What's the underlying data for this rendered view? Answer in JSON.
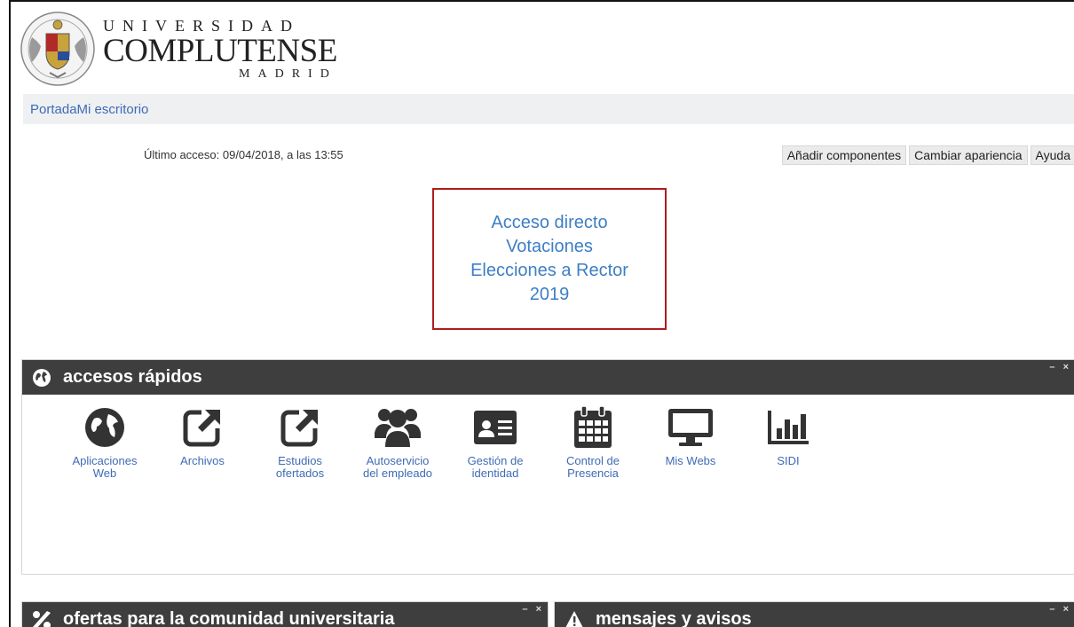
{
  "header": {
    "logo_line1": "UNIVERSIDAD",
    "logo_line2": "COMPLUTENSE",
    "logo_line3": "MADRID"
  },
  "breadcrumb": {
    "items": [
      "Portada",
      "Mi escritorio"
    ]
  },
  "user": {
    "last_access": "Último acceso: 09/04/2018, a las 13:55"
  },
  "toolbar": {
    "add_components": "Añadir componentes",
    "change_appearance": "Cambiar apariencia",
    "help": "Ayuda"
  },
  "vote_link": {
    "line1": "Acceso directo",
    "line2": "Votaciones",
    "line3": "Elecciones a Rector",
    "line4": "2019",
    "border_color": "#b01c1c",
    "text_color": "#3d7fc4"
  },
  "quick_access": {
    "title": "accesos rápidos",
    "controls": "– ×",
    "icon": "globe-icon",
    "items": [
      {
        "label": "Aplicaciones\nWeb",
        "icon": "globe-icon"
      },
      {
        "label": "Archivos",
        "icon": "external-link-icon"
      },
      {
        "label": "Estudios\nofertados",
        "icon": "external-link-icon"
      },
      {
        "label": "Autoservicio\ndel empleado",
        "icon": "users-icon"
      },
      {
        "label": "Gestión de\nidentidad",
        "icon": "id-card-icon"
      },
      {
        "label": "Control de\nPresencia",
        "icon": "calendar-icon"
      },
      {
        "label": "Mis Webs",
        "icon": "monitor-icon"
      },
      {
        "label": "SIDI",
        "icon": "bar-chart-icon"
      }
    ]
  },
  "offers_block": {
    "title": "ofertas para la comunidad universitaria",
    "controls": "– ×",
    "icon": "percent-icon"
  },
  "messages_block": {
    "title": "mensajes y avisos",
    "controls": "– ×",
    "icon": "warning-icon"
  },
  "colors": {
    "header_dark": "#3e3e3e",
    "link_blue": "#3f6bb5",
    "breadcrumb_bg": "#eef0f2"
  }
}
